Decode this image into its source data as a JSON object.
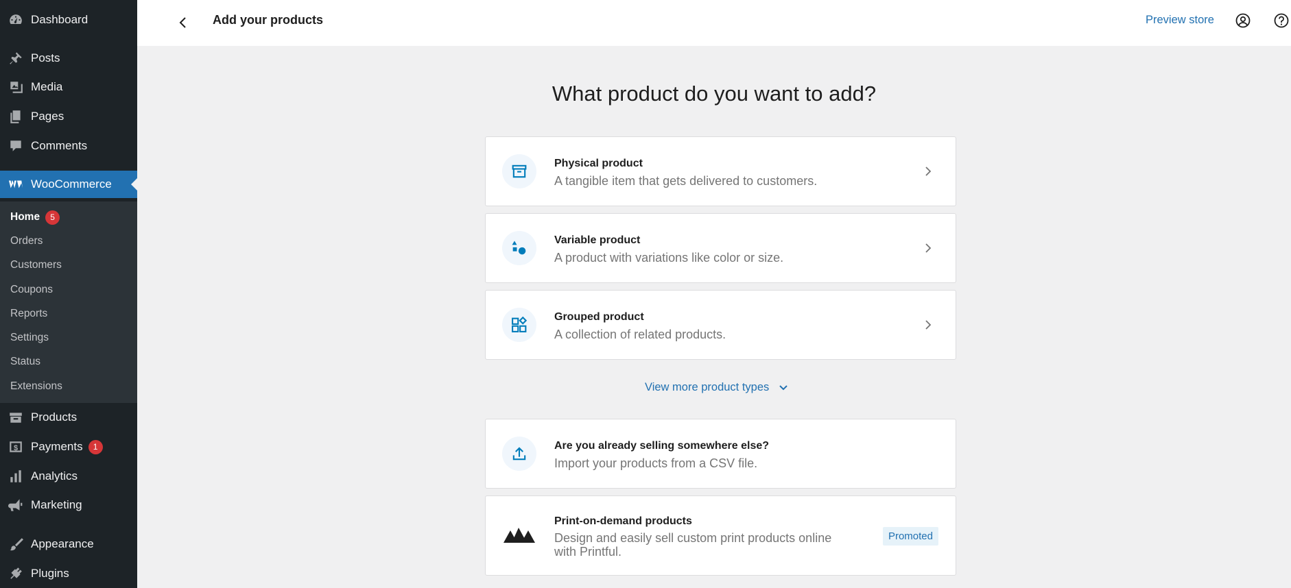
{
  "sidebar": {
    "dashboard": "Dashboard",
    "posts": "Posts",
    "media": "Media",
    "pages": "Pages",
    "comments": "Comments",
    "woocommerce": "WooCommerce",
    "submenu": {
      "home": "Home",
      "home_badge": "5",
      "orders": "Orders",
      "customers": "Customers",
      "coupons": "Coupons",
      "reports": "Reports",
      "settings": "Settings",
      "status": "Status",
      "extensions": "Extensions"
    },
    "products": "Products",
    "payments": "Payments",
    "payments_badge": "1",
    "analytics": "Analytics",
    "marketing": "Marketing",
    "appearance": "Appearance",
    "plugins": "Plugins"
  },
  "header": {
    "title": "Add your products",
    "preview_store": "Preview store"
  },
  "main": {
    "heading": "What product do you want to add?",
    "cards": [
      {
        "title": "Physical product",
        "description": "A tangible item that gets delivered to customers."
      },
      {
        "title": "Variable product",
        "description": "A product with variations like color or size."
      },
      {
        "title": "Grouped product",
        "description": "A collection of related products."
      }
    ],
    "view_more": "View more product types",
    "import": {
      "title": "Are you already selling somewhere else?",
      "description": "Import your products from a CSV file."
    },
    "printful": {
      "title": "Print-on-demand products",
      "description_line1": "Design and easily sell custom print products online",
      "description_line2": "with Printful.",
      "badge": "Promoted"
    }
  },
  "colors": {
    "accent": "#2271b1",
    "sidebar_bg": "#1d2327",
    "submenu_bg": "#2c3338",
    "badge": "#d63638"
  }
}
